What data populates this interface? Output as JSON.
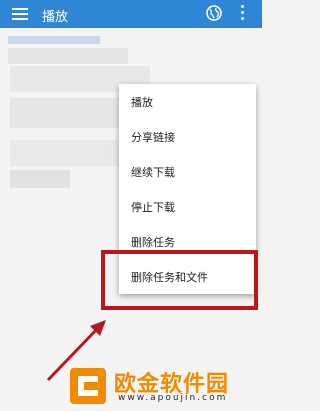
{
  "header": {
    "title": "播放",
    "menu_icon": "hamburger-menu-icon",
    "globe_icon": "globe-icon",
    "more_icon": "more-vert-icon"
  },
  "context_menu": {
    "items": [
      {
        "label": "播放"
      },
      {
        "label": "分享链接"
      },
      {
        "label": "继续下载"
      },
      {
        "label": "停止下载"
      },
      {
        "label": "删除任务"
      },
      {
        "label": "删除任务和文件"
      }
    ]
  },
  "annotation": {
    "box_color": "#b8181a",
    "arrow_color": "#b8181a"
  },
  "watermark": {
    "title": "欧金软件园",
    "url": "www.apoujin.com"
  },
  "colors": {
    "appbar": "#2f86d4",
    "accent": "#f08a00"
  }
}
